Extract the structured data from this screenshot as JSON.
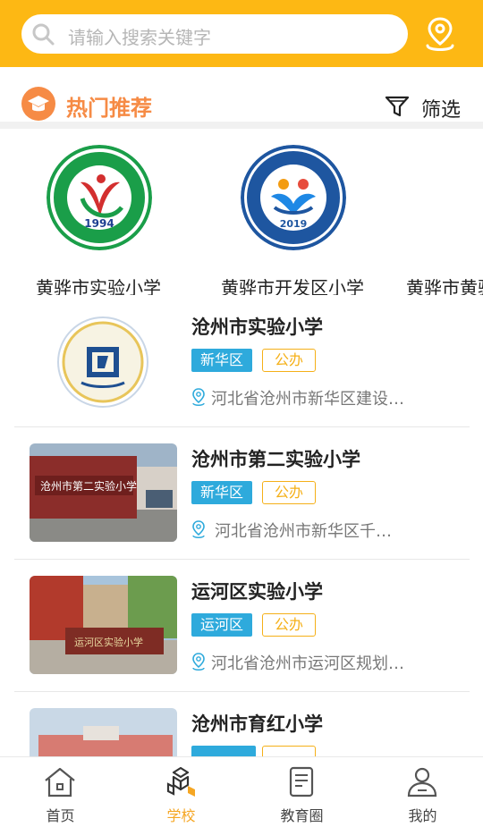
{
  "search": {
    "placeholder": "请输入搜索关键字"
  },
  "section": {
    "title": "热门推荐",
    "filter_label": "筛选"
  },
  "hot_schools": [
    {
      "name": "黄骅市实验小学",
      "logo_year": "1994"
    },
    {
      "name": "黄骅市开发区小学",
      "logo_year": "2019"
    },
    {
      "name": "黄骅市黄骅镇小学"
    }
  ],
  "schools": [
    {
      "name": "沧州市实验小学",
      "district": "新华区",
      "type": "公办",
      "address": "河北省沧州市新华区建设…"
    },
    {
      "name": "沧州市第二实验小学",
      "district": "新华区",
      "type": "公办",
      "address": "河北省沧州市新华区千…"
    },
    {
      "name": "运河区实验小学",
      "district": "运河区",
      "type": "公办",
      "address": "河北省沧州市运河区规划…"
    },
    {
      "name": "沧州市育红小学",
      "district": "",
      "type": ""
    }
  ],
  "tabs": [
    {
      "label": "首页",
      "icon": "home-icon"
    },
    {
      "label": "学校",
      "icon": "school-icon"
    },
    {
      "label": "教育圈",
      "icon": "document-icon"
    },
    {
      "label": "我的",
      "icon": "profile-icon"
    }
  ],
  "colors": {
    "accent": "#FDB814",
    "section": "#F68B45",
    "district_tag": "#2EAADC",
    "type_tag": "#F5B018",
    "active_tab": "#F5A623"
  }
}
